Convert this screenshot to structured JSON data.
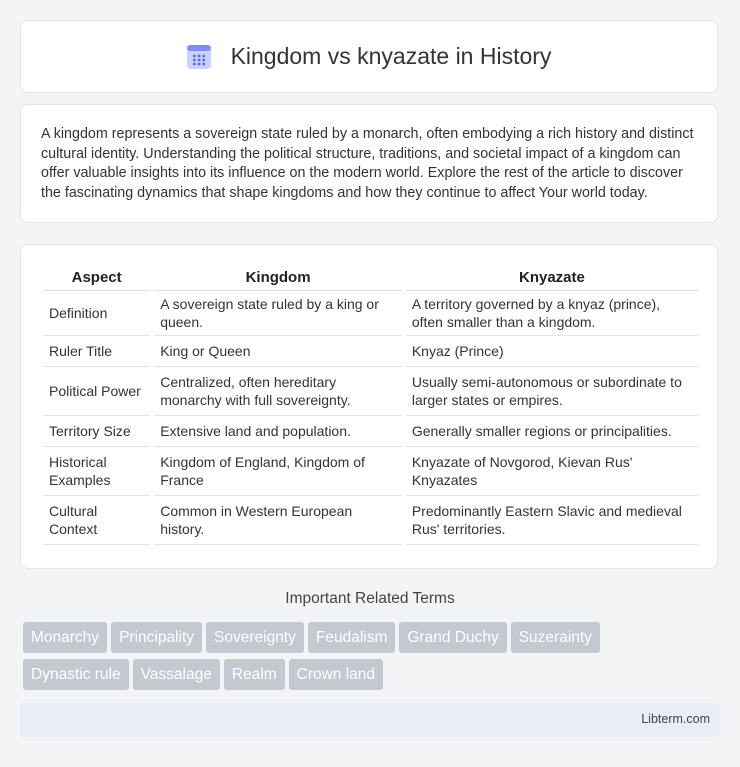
{
  "header": {
    "title": "Kingdom vs knyazate in History",
    "icon": "calendar-grid-icon"
  },
  "intro": "A kingdom represents a sovereign state ruled by a monarch, often embodying a rich history and distinct cultural identity. Understanding the political structure, traditions, and societal impact of a kingdom can offer valuable insights into its influence on the modern world. Explore the rest of the article to discover the fascinating dynamics that shape kingdoms and how they continue to affect Your world today.",
  "table": {
    "headers": [
      "Aspect",
      "Kingdom",
      "Knyazate"
    ],
    "rows": [
      [
        "Definition",
        "A sovereign state ruled by a king or queen.",
        "A territory governed by a knyaz (prince), often smaller than a kingdom."
      ],
      [
        "Ruler Title",
        "King or Queen",
        "Knyaz (Prince)"
      ],
      [
        "Political Power",
        "Centralized, often hereditary monarchy with full sovereignty.",
        "Usually semi-autonomous or subordinate to larger states or empires."
      ],
      [
        "Territory Size",
        "Extensive land and population.",
        "Generally smaller regions or principalities."
      ],
      [
        "Historical Examples",
        "Kingdom of England, Kingdom of France",
        "Knyazate of Novgorod, Kievan Rus' Knyazates"
      ],
      [
        "Cultural Context",
        "Common in Western European history.",
        "Predominantly Eastern Slavic and medieval Rus' territories."
      ]
    ]
  },
  "related": {
    "title": "Important Related Terms",
    "tags": [
      "Monarchy",
      "Principality",
      "Sovereignty",
      "Feudalism",
      "Grand Duchy",
      "Suzerainty",
      "Dynastic rule",
      "Vassalage",
      "Realm",
      "Crown land"
    ]
  },
  "footer": {
    "site": "Libterm.com"
  }
}
